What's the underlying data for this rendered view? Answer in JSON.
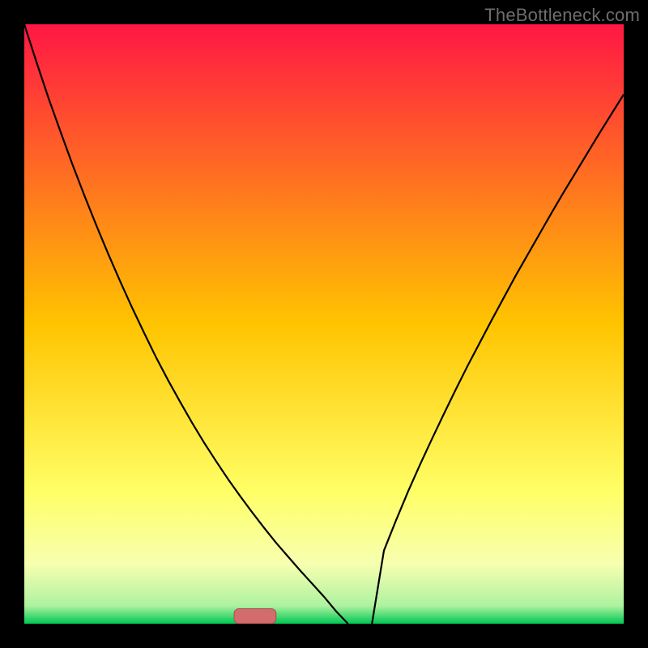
{
  "watermark": "TheBottleneck.com",
  "chart_data": {
    "type": "line",
    "title": "",
    "xlabel": "",
    "ylabel": "",
    "xlim": [
      0,
      1
    ],
    "ylim": [
      0,
      1
    ],
    "x": [
      0.0,
      0.02,
      0.04,
      0.06,
      0.08,
      0.1,
      0.12,
      0.14,
      0.16,
      0.18,
      0.2,
      0.22,
      0.24,
      0.26,
      0.28,
      0.3,
      0.32,
      0.34,
      0.36,
      0.38,
      0.4,
      0.42,
      0.44,
      0.46,
      0.48,
      0.5,
      0.52,
      0.54,
      0.56,
      0.58,
      0.6,
      0.62,
      0.64,
      0.66,
      0.68,
      0.7,
      0.72,
      0.74,
      0.76,
      0.78,
      0.8,
      0.82,
      0.84,
      0.86,
      0.88,
      0.9,
      0.92,
      0.94,
      0.96,
      0.98,
      1.0
    ],
    "y": [
      1.0,
      0.938,
      0.878,
      0.822,
      0.767,
      0.715,
      0.665,
      0.617,
      0.571,
      0.527,
      0.485,
      0.444,
      0.406,
      0.37,
      0.335,
      0.302,
      0.271,
      0.241,
      0.213,
      0.186,
      0.16,
      0.135,
      0.112,
      0.089,
      0.067,
      0.045,
      0.021,
      0.0,
      0.0,
      0.0,
      0.122,
      0.172,
      0.22,
      0.265,
      0.308,
      0.35,
      0.391,
      0.431,
      0.469,
      0.507,
      0.544,
      0.581,
      0.616,
      0.651,
      0.686,
      0.72,
      0.753,
      0.786,
      0.819,
      0.851,
      0.883
    ],
    "gradient_stops": [
      {
        "offset": 0.0,
        "color": "#ff1744"
      },
      {
        "offset": 0.5,
        "color": "#ffc400"
      },
      {
        "offset": 0.78,
        "color": "#ffff66"
      },
      {
        "offset": 0.9,
        "color": "#f7ffb0"
      },
      {
        "offset": 0.97,
        "color": "#aef2a0"
      },
      {
        "offset": 1.0,
        "color": "#00c853"
      }
    ],
    "marker": {
      "x": 0.385,
      "y": 0.0,
      "half_width": 0.035,
      "height": 0.025,
      "color": "#d36d6d",
      "border": "#a94d4d"
    },
    "annotations": []
  }
}
